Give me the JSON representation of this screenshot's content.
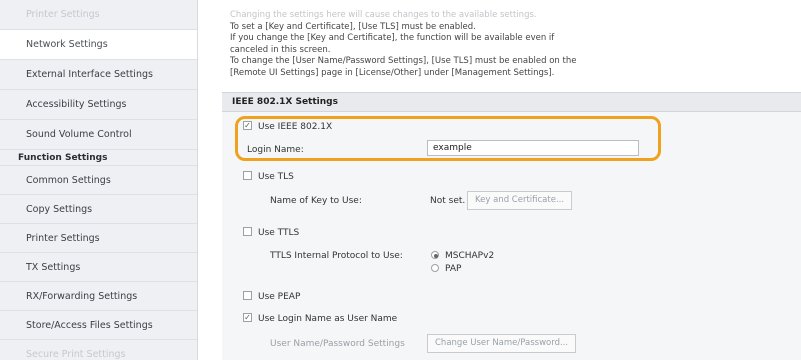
{
  "sidebar": {
    "items_top": [
      {
        "label": "Printer Settings",
        "faded": true
      },
      {
        "label": "Network Settings",
        "selected": true
      },
      {
        "label": "External Interface Settings"
      },
      {
        "label": "Accessibility Settings"
      },
      {
        "label": "Sound Volume Control"
      }
    ],
    "section_header": "Function Settings",
    "items_bottom": [
      {
        "label": "Common Settings"
      },
      {
        "label": "Copy Settings"
      },
      {
        "label": "Printer Settings"
      },
      {
        "label": "TX Settings"
      },
      {
        "label": "RX/Forwarding Settings"
      },
      {
        "label": "Store/Access Files Settings"
      },
      {
        "label": "Secure Print Settings",
        "faded": true
      }
    ]
  },
  "note": {
    "line0": "Changing the settings here will cause changes to the available settings.",
    "line1": "To set a [Key and Certificate], [Use TLS] must be enabled.",
    "line2": "If you change the [Key and Certificate], the function will be available even if",
    "line3": "canceled in this screen.",
    "line4": "To change the [User Name/Password Settings], [Use TLS] must be enabled on the",
    "line5": "[Remote UI Settings] page in [License/Other] under [Management Settings]."
  },
  "section_title": "IEEE 802.1X Settings",
  "use_ieee": {
    "label": "Use IEEE 802.1X",
    "checked": true
  },
  "login_name": {
    "label": "Login Name:",
    "value": "example"
  },
  "use_tls": {
    "label": "Use TLS",
    "checked": false
  },
  "key_to_use": {
    "label": "Name of Key to Use:",
    "value": "Not set.",
    "button": "Key and Certificate..."
  },
  "use_ttls": {
    "label": "Use TTLS",
    "checked": false
  },
  "ttls_protocol": {
    "label": "TTLS Internal Protocol to Use:",
    "option1": "MSCHAPv2",
    "option2": "PAP",
    "selected": "MSCHAPv2"
  },
  "use_peap": {
    "label": "Use PEAP",
    "checked": false
  },
  "use_login_as_user": {
    "label": "Use Login Name as User Name",
    "checked": true
  },
  "user_pw_settings": {
    "label": "User Name/Password Settings",
    "button": "Change User Name/Password..."
  },
  "colors": {
    "highlight": "#f0a21f",
    "sidebar_bg": "#eef0f3",
    "section_bg": "#e8eaee"
  }
}
